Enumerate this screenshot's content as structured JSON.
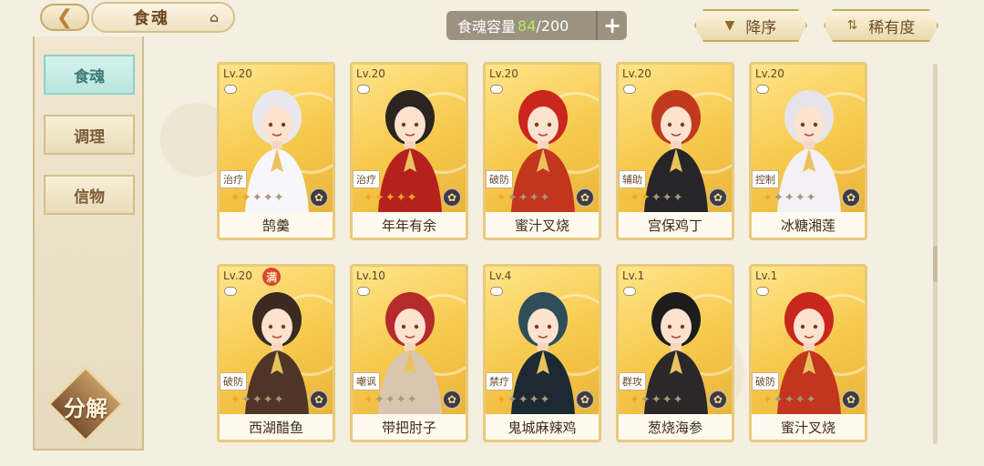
{
  "header": {
    "back_icon": "back-arrow-icon",
    "title": "食魂",
    "home_icon": "house-icon",
    "capacity_label": "食魂容量",
    "capacity_current": "84",
    "capacity_total": "/200",
    "capacity_add": "+",
    "sort_desc_label": "降序",
    "sort_rarity_label": "稀有度"
  },
  "sidebar": {
    "items": [
      {
        "label": "食魂",
        "active": true
      },
      {
        "label": "调理",
        "active": false
      },
      {
        "label": "信物",
        "active": false
      }
    ],
    "decompose_label": "分解"
  },
  "cards": [
    {
      "level": "Lv.20",
      "role": "治疗",
      "stars_on": 2,
      "stars_total": 5,
      "name": "鹄羹",
      "full": "",
      "hair": "#e8e8ee",
      "outfit": "#f7f7fb"
    },
    {
      "level": "Lv.20",
      "role": "治疗",
      "stars_on": 5,
      "stars_total": 5,
      "name": "年年有余",
      "full": "",
      "hair": "#2b2421",
      "outfit": "#b5221e"
    },
    {
      "level": "Lv.20",
      "role": "破防",
      "stars_on": 1,
      "stars_total": 5,
      "name": "蜜汁叉烧",
      "full": "",
      "hair": "#c9261d",
      "outfit": "#c2351e"
    },
    {
      "level": "Lv.20",
      "role": "辅助",
      "stars_on": 2,
      "stars_total": 5,
      "name": "宫保鸡丁",
      "full": "",
      "hair": "#c13a1e",
      "outfit": "#262628"
    },
    {
      "level": "Lv.20",
      "role": "控制",
      "stars_on": 1,
      "stars_total": 5,
      "name": "冰糖湘莲",
      "full": "",
      "hair": "#e6e4ea",
      "outfit": "#f3f1f4"
    },
    {
      "level": "Lv.20",
      "role": "破防",
      "stars_on": 1,
      "stars_total": 5,
      "name": "西湖醋鱼",
      "full": "满",
      "hair": "#3a2a20",
      "outfit": "#4f3526"
    },
    {
      "level": "Lv.10",
      "role": "嘲讽",
      "stars_on": 1,
      "stars_total": 5,
      "name": "带把肘子",
      "full": "",
      "hair": "#b52a2c",
      "outfit": "#d9c6b1"
    },
    {
      "level": "Lv.4",
      "role": "禁疗",
      "stars_on": 1,
      "stars_total": 5,
      "name": "鬼城麻辣鸡",
      "full": "",
      "hair": "#2f4d5a",
      "outfit": "#1d2a33"
    },
    {
      "level": "Lv.1",
      "role": "群攻",
      "stars_on": 1,
      "stars_total": 5,
      "name": "葱烧海参",
      "full": "",
      "hair": "#1e1c1c",
      "outfit": "#2a2828"
    },
    {
      "level": "Lv.1",
      "role": "破防",
      "stars_on": 1,
      "stars_total": 5,
      "name": "蜜汁叉烧",
      "full": "",
      "hair": "#c9261d",
      "outfit": "#c2351e"
    }
  ],
  "colors": {
    "card_border": "#e9c97c",
    "active_tab": "#b9e5df",
    "capacity_current": "#b8e86a"
  }
}
